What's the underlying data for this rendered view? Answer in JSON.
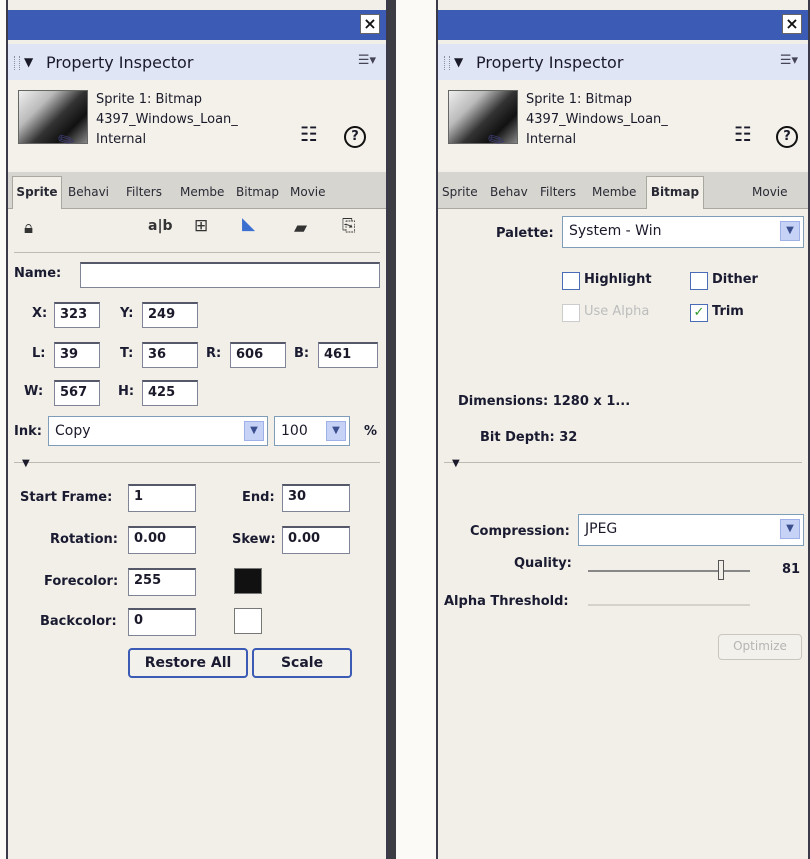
{
  "left_panel": {
    "title": "Property Inspector",
    "sprite_line1": "Sprite 1: Bitmap",
    "sprite_line2": "4397_Windows_Loan_",
    "sprite_line3": "Internal",
    "tabs": [
      "Sprite",
      "Behavi",
      "Filters",
      "Membe",
      "Bitmap",
      "Movie"
    ],
    "name_label": "Name:",
    "name_value": "",
    "x_label": "X:",
    "x_value": "323",
    "y_label": "Y:",
    "y_value": "249",
    "l_label": "L:",
    "l_value": "39",
    "t_label": "T:",
    "t_value": "36",
    "r_label": "R:",
    "r_value": "606",
    "b_label": "B:",
    "b_value": "461",
    "w_label": "W:",
    "w_value": "567",
    "h_label": "H:",
    "h_value": "425",
    "ink_label": "Ink:",
    "ink_value": "Copy",
    "blend_value": "100",
    "percent": "%",
    "start_label": "Start Frame:",
    "start_value": "1",
    "end_label": "End:",
    "end_value": "30",
    "rotation_label": "Rotation:",
    "rotation_value": "0.00",
    "skew_label": "Skew:",
    "skew_value": "0.00",
    "forecolor_label": "Forecolor:",
    "forecolor_value": "255",
    "backcolor_label": "Backcolor:",
    "backcolor_value": "0",
    "restore_button": "Restore All",
    "scale_button": "Scale",
    "forecolor_swatch": "#111111",
    "backcolor_swatch": "#ffffff"
  },
  "right_panel": {
    "title": "Property Inspector",
    "sprite_line1": "Sprite 1: Bitmap",
    "sprite_line2": "4397_Windows_Loan_",
    "sprite_line3": "Internal",
    "tabs": [
      "Sprite",
      "Behav",
      "Filters",
      "Membe",
      "Bitmap",
      "Movie"
    ],
    "palette_label": "Palette:",
    "palette_value": "System - Win",
    "highlight_label": "Highlight",
    "dither_label": "Dither",
    "use_alpha_label": "Use Alpha",
    "trim_label": "Trim",
    "dimensions_text": "Dimensions: 1280 x 1...",
    "bitdepth_text": "Bit Depth: 32",
    "compression_label": "Compression:",
    "compression_value": "JPEG",
    "quality_label": "Quality:",
    "quality_value": "81",
    "alpha_threshold_label": "Alpha Threshold:",
    "optimize_button": "Optimize",
    "highlight_checked": false,
    "dither_checked": false,
    "use_alpha_checked": false,
    "trim_checked": true
  },
  "colors": {
    "titlebar": "#3b5bb4",
    "accent": "#3b5bb4"
  },
  "icons": [
    "close-icon",
    "menu-icon",
    "list-icon",
    "help-icon",
    "lock-icon",
    "flip-icon",
    "toolbar-icon"
  ]
}
